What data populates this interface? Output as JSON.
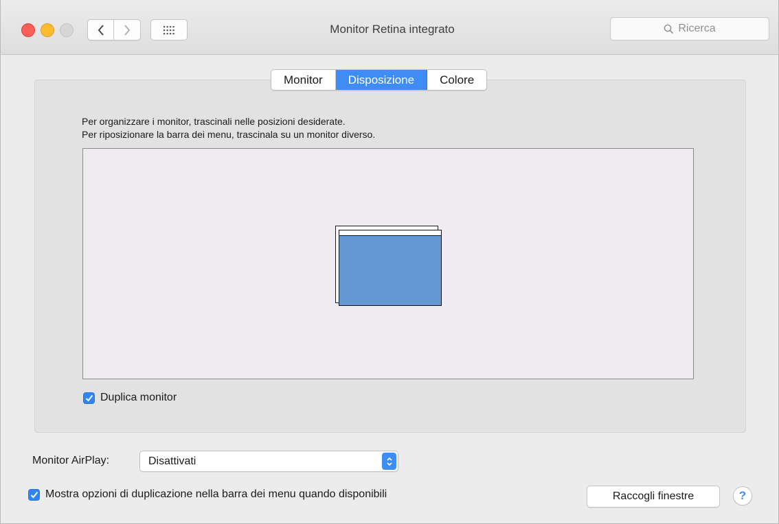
{
  "window": {
    "title": "Monitor Retina integrato",
    "search_placeholder": "Ricerca"
  },
  "tabs": [
    {
      "label": "Monitor",
      "active": false
    },
    {
      "label": "Disposizione",
      "active": true
    },
    {
      "label": "Colore",
      "active": false
    }
  ],
  "arrangement": {
    "instruction_line1": "Per organizzare i monitor, trascinali nelle posizioni desiderate.",
    "instruction_line2": "Per riposizionare la barra dei menu, trascinala su un monitor diverso.",
    "mirror_checkbox_label": "Duplica monitor",
    "mirror_checked": true
  },
  "airplay": {
    "label": "Monitor AirPlay:",
    "selected": "Disattivati"
  },
  "footer": {
    "show_mirroring_label": "Mostra opzioni di duplicazione nella barra dei menu quando disponibili",
    "show_mirroring_checked": true,
    "gather_windows_label": "Raccogli finestre",
    "help_label": "?"
  },
  "colors": {
    "accent": "#3d8df5",
    "monitor_fill": "#6299d3",
    "arrange_bg": "#f0ebf0",
    "close": "#fc5f57",
    "minimize": "#fdbc2e"
  },
  "icons": {
    "back": "chevron-left-icon",
    "forward": "chevron-right-icon",
    "grid": "grid-icon",
    "search": "search-icon",
    "checkmark": "checkmark-icon",
    "select": "up-down-arrows-icon"
  }
}
